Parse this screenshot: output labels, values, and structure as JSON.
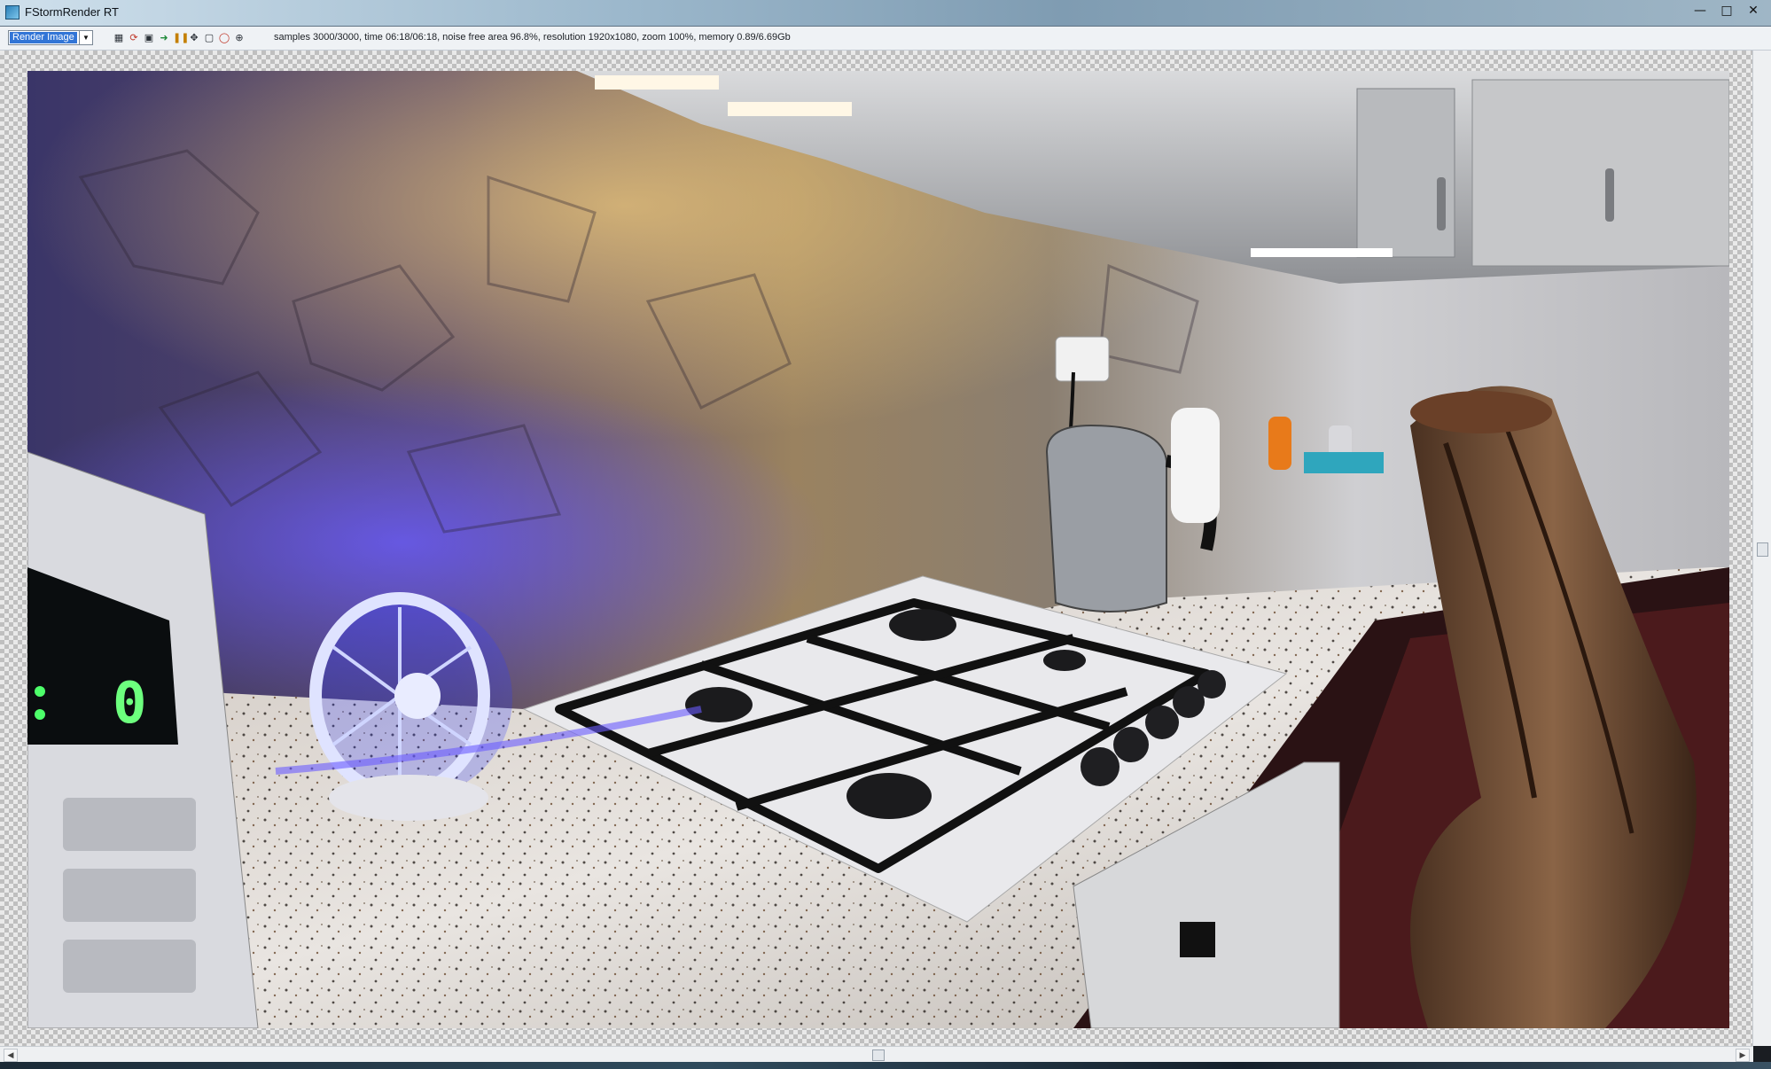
{
  "window": {
    "title": "FStormRender RT",
    "controls": [
      "minimize-icon",
      "maximize-icon",
      "close-icon"
    ]
  },
  "toolbar": {
    "channel_select": {
      "value": "Render Image"
    },
    "icons": [
      "region-icon",
      "refresh-icon",
      "save-icon",
      "export-icon",
      "pause-icon",
      "fit-icon",
      "frame-icon",
      "zoom-region-icon",
      "lock-icon"
    ],
    "status": "samples 3000/3000,  time 06:18/06:18,  noise free area 96.8%,  resolution 1920x1080,  zoom 100%,  memory 0.89/6.69Gb"
  },
  "render": {
    "description_icon": "render-preview",
    "display_digit": "0"
  },
  "scrollbars": {
    "vertical": "scrollbar",
    "horizontal": "scrollbar"
  },
  "colors": {
    "accent": "#3275d6",
    "title_gradient_start": "#cfe0ec",
    "checker": "#bfbfbf"
  }
}
